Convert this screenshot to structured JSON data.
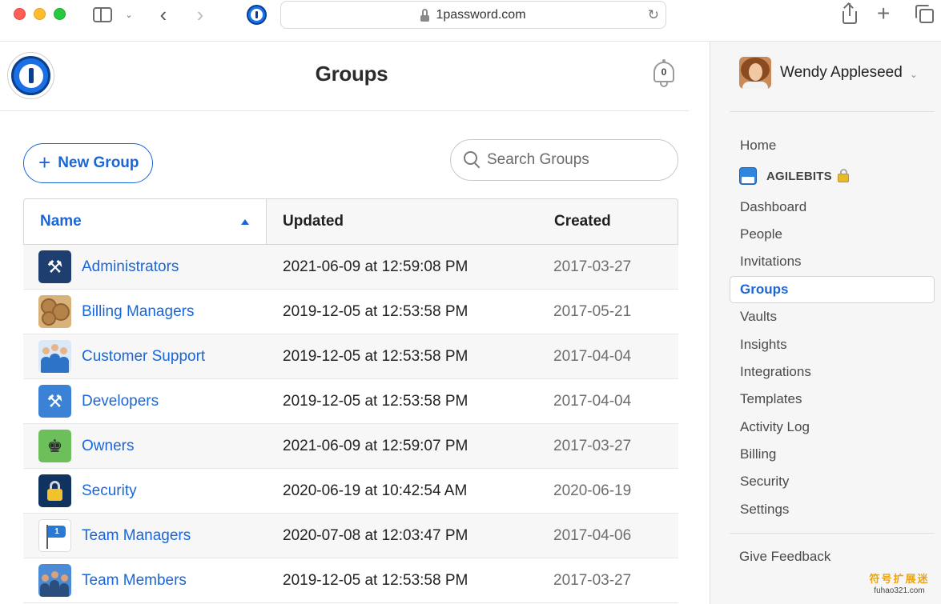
{
  "browser": {
    "url": "1password.com",
    "icons": {
      "sidebar_toggle": "sidebar-icon",
      "back": "chevron-left-icon",
      "forward": "chevron-right-icon",
      "extension": "1password-extension-icon",
      "lock": "lock-icon",
      "reload": "reload-icon",
      "share": "share-icon",
      "new_tab": "plus-icon",
      "tabs": "tabs-overview-icon"
    },
    "back_glyph": "‹",
    "forward_glyph": "›",
    "sidebar_chevron_glyph": "⌄",
    "reload_glyph": "↻",
    "new_tab_glyph": "+"
  },
  "header": {
    "title": "Groups",
    "notification_count": "0"
  },
  "toolbar": {
    "new_group_plus": "+",
    "new_group_label": "New Group",
    "search_placeholder": "Search Groups"
  },
  "table": {
    "columns": {
      "name": "Name",
      "updated": "Updated",
      "created": "Created"
    },
    "sort": {
      "column": "name",
      "direction": "ascending"
    },
    "rows": [
      {
        "name": "Administrators",
        "updated": "2021-06-09 at 12:59:08 PM",
        "created": "2017-03-27",
        "icon": "tools-icon",
        "glyph": "⚒"
      },
      {
        "name": "Billing Managers",
        "updated": "2019-12-05 at 12:53:58 PM",
        "created": "2017-05-21",
        "icon": "coins-icon",
        "glyph": ""
      },
      {
        "name": "Customer Support",
        "updated": "2019-12-05 at 12:53:58 PM",
        "created": "2017-04-04",
        "icon": "people-icon",
        "glyph": ""
      },
      {
        "name": "Developers",
        "updated": "2019-12-05 at 12:53:58 PM",
        "created": "2017-04-04",
        "icon": "wrench-icon",
        "glyph": "⚒"
      },
      {
        "name": "Owners",
        "updated": "2021-06-09 at 12:59:07 PM",
        "created": "2017-03-27",
        "icon": "chess-icon",
        "glyph": "♚"
      },
      {
        "name": "Security",
        "updated": "2020-06-19 at 10:42:54 AM",
        "created": "2020-06-19",
        "icon": "padlock-icon",
        "glyph": ""
      },
      {
        "name": "Team Managers",
        "updated": "2020-07-08 at 12:03:47 PM",
        "created": "2017-04-06",
        "icon": "flag-icon",
        "glyph": ""
      },
      {
        "name": "Team Members",
        "updated": "2019-12-05 at 12:53:58 PM",
        "created": "2017-03-27",
        "icon": "team-icon",
        "glyph": ""
      }
    ]
  },
  "sidebar": {
    "user_name": "Wendy Appleseed",
    "user_chevron": "⌄",
    "account_name": "AGILEBITS",
    "home": "Home",
    "items": [
      {
        "label": "Dashboard",
        "active": false
      },
      {
        "label": "People",
        "active": false
      },
      {
        "label": "Invitations",
        "active": false
      },
      {
        "label": "Groups",
        "active": true
      },
      {
        "label": "Vaults",
        "active": false
      },
      {
        "label": "Insights",
        "active": false
      },
      {
        "label": "Integrations",
        "active": false
      },
      {
        "label": "Templates",
        "active": false
      },
      {
        "label": "Activity Log",
        "active": false
      },
      {
        "label": "Billing",
        "active": false
      },
      {
        "label": "Security",
        "active": false
      },
      {
        "label": "Settings",
        "active": false
      }
    ],
    "feedback": "Give Feedback"
  },
  "watermark": {
    "line1": "符号扩展迷",
    "line2": "fuhao321.com"
  },
  "colors": {
    "accent": "#1a66d9",
    "panel_bg": "#f6f6f7",
    "row_alt": "#f7f7f8"
  }
}
